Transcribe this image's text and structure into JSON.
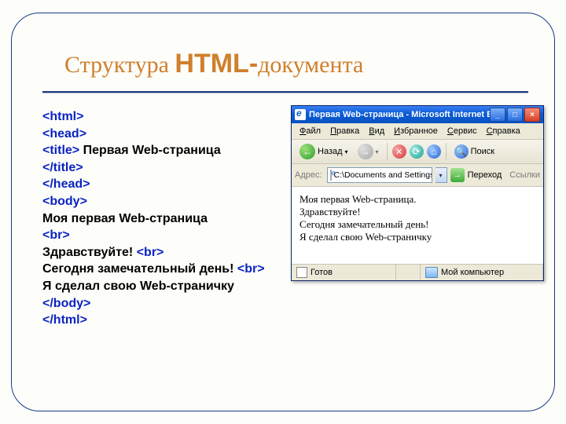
{
  "slide": {
    "title_pre": "Структура ",
    "title_html": "HTML-",
    "title_post": "документа"
  },
  "code": {
    "l1": "<html>",
    "l2": "<head>",
    "l3a": "<title>",
    "l3b": " Первая  Web-страница",
    "l4": "</title>",
    "l5": "</head>",
    "l6": "<body>",
    "l7": "Моя первая Web-страница",
    "l8": "<br>",
    "l9a": "Здравствуйте! ",
    "l9b": "<br>",
    "l10a": "Сегодня замечательный день! ",
    "l10b": "<br>",
    "l11": "Я сделал свою Web-страничку",
    "l12": "</body>",
    "l13": "</html>"
  },
  "browser": {
    "title": "Первая Web-страница - Microsoft Internet E...",
    "menu": [
      "Файл",
      "Правка",
      "Вид",
      "Избранное",
      "Сервис",
      "Справка"
    ],
    "toolbar": {
      "back": "Назад",
      "search": "Поиск"
    },
    "address": {
      "label": "Адрес:",
      "path": "C:\\Documents and Settings\\Роз",
      "go": "Переход",
      "links": "Ссылки"
    },
    "page": {
      "l1": "Моя первая Web-страница.",
      "l2": "Здравствуйте!",
      "l3": "Сегодня замечательный день!",
      "l4": "Я сделал свою Web-страничку"
    },
    "status": {
      "ready": "Готов",
      "zone": "Мой компьютер"
    }
  }
}
